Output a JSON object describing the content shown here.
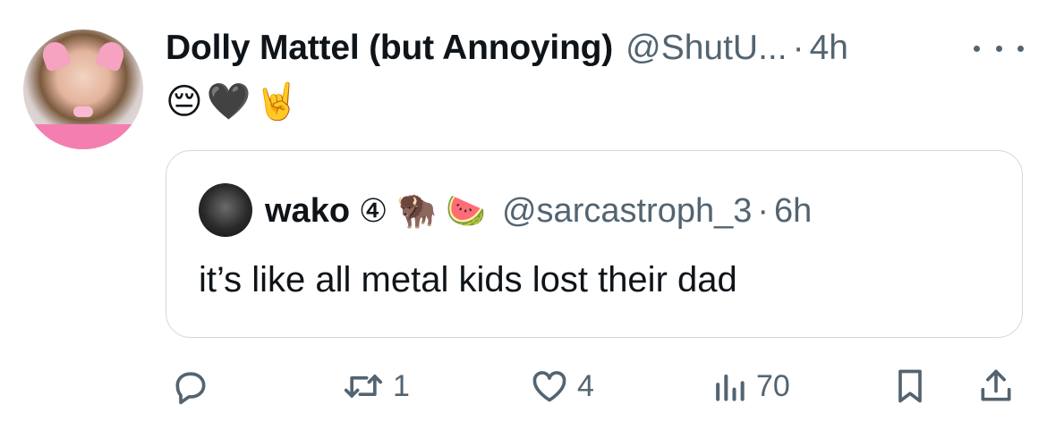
{
  "tweet": {
    "author_name": "Dolly Mattel (but Annoying)",
    "handle": "@ShutU...",
    "separator": "·",
    "time": "4h",
    "text": "😔🖤🤘"
  },
  "quote": {
    "author_name": "wako",
    "badges": "④ 🦬 🍉",
    "handle": "@sarcastroph_3",
    "separator": "·",
    "time": "6h",
    "text": "it’s like all metal kids lost their dad"
  },
  "actions": {
    "reply_count": "",
    "retweet_count": "1",
    "like_count": "4",
    "views_count": "70"
  },
  "icons": [
    "more-icon",
    "reply-icon",
    "retweet-icon",
    "like-icon",
    "views-icon",
    "bookmark-icon",
    "share-icon"
  ],
  "colors": {
    "text": "#0f1419",
    "secondary": "#536471",
    "border": "#cfd9de"
  }
}
